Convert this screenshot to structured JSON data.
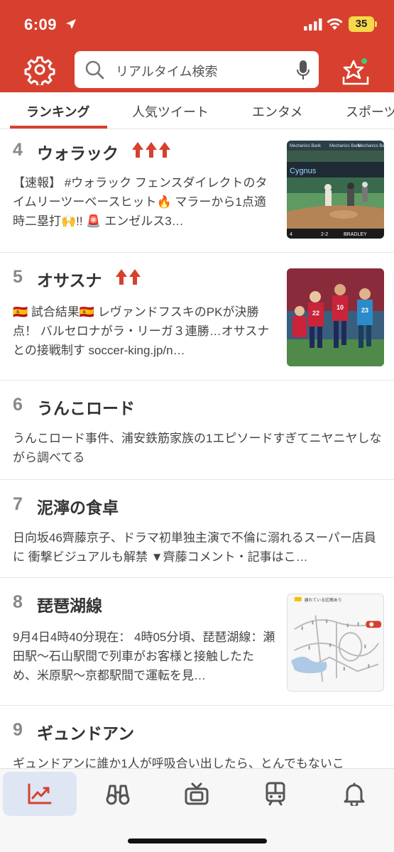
{
  "status": {
    "time": "6:09",
    "battery": "35"
  },
  "header": {
    "search_placeholder": "リアルタイム検索"
  },
  "tabs": [
    {
      "label": "ランキング",
      "active": true
    },
    {
      "label": "人気ツイート"
    },
    {
      "label": "エンタメ"
    },
    {
      "label": "スポーツ"
    }
  ],
  "items": [
    {
      "rank": "4",
      "title": "ウォラック",
      "arrows": 3,
      "desc": "【速報】 #ウォラック フェンスダイレクトのタイムリーツーベースヒット🔥 マラーから1点適時二塁打🙌!! 🚨 エンゼルス3…",
      "thumb": "baseball",
      "thumb_texts": {
        "brand": "Mechanics Bank",
        "team_l": "Cygnus",
        "score_l": "4",
        "count": "2-2",
        "player": "BRADLEY"
      }
    },
    {
      "rank": "5",
      "title": "オサスナ",
      "arrows": 2,
      "desc": "🇪🇸 試合結果🇪🇸 レヴァンドフスキのPKが決勝点！ バルセロナがラ・リーガ３連勝…オサスナとの接戦制す soccer-king.jp/n…",
      "thumb": "soccer",
      "thumb_texts": {
        "jersey_a": "22",
        "jersey_b": "10",
        "jersey_c": "23"
      }
    },
    {
      "rank": "6",
      "title": "うんこロード",
      "arrows": 0,
      "desc": "うんこロード事件、浦安鉄筋家族の1エピソードすぎてニヤニヤしながら調べてる"
    },
    {
      "rank": "7",
      "title": "泥濘の食卓",
      "arrows": 0,
      "desc": "日向坂46齊藤京子、ドラマ初単独主演で不倫に溺れるスーパー店員に 衝撃ビジュアルも解禁 ▼齊藤コメント・記事はこ…"
    },
    {
      "rank": "8",
      "title": "琵琶湖線",
      "arrows": 0,
      "desc": "9月4日4時40分現在： 4時05分頃、琵琶湖線：瀬田駅〜石山駅間で列車がお客様と接触したため、米原駅〜京都駅間で運転を見…",
      "thumb": "map",
      "thumb_texts": {
        "legend": "遅れている区間あり"
      }
    },
    {
      "rank": "9",
      "title": "ギュンドアン",
      "arrows": 0,
      "desc": "ギュンドアンに誰か1人が呼吸合い出したら、とんでもないこ"
    }
  ],
  "nav": [
    {
      "name": "ranking",
      "icon": "trend-chart-icon",
      "active": true
    },
    {
      "name": "discover",
      "icon": "binoculars-icon"
    },
    {
      "name": "tv",
      "icon": "tv-icon"
    },
    {
      "name": "train",
      "icon": "train-icon"
    },
    {
      "name": "notifications",
      "icon": "bell-icon"
    }
  ],
  "colors": {
    "brand": "#d7402f",
    "arrow": "#d7402f",
    "nav_active_bg": "#dde6f2"
  }
}
